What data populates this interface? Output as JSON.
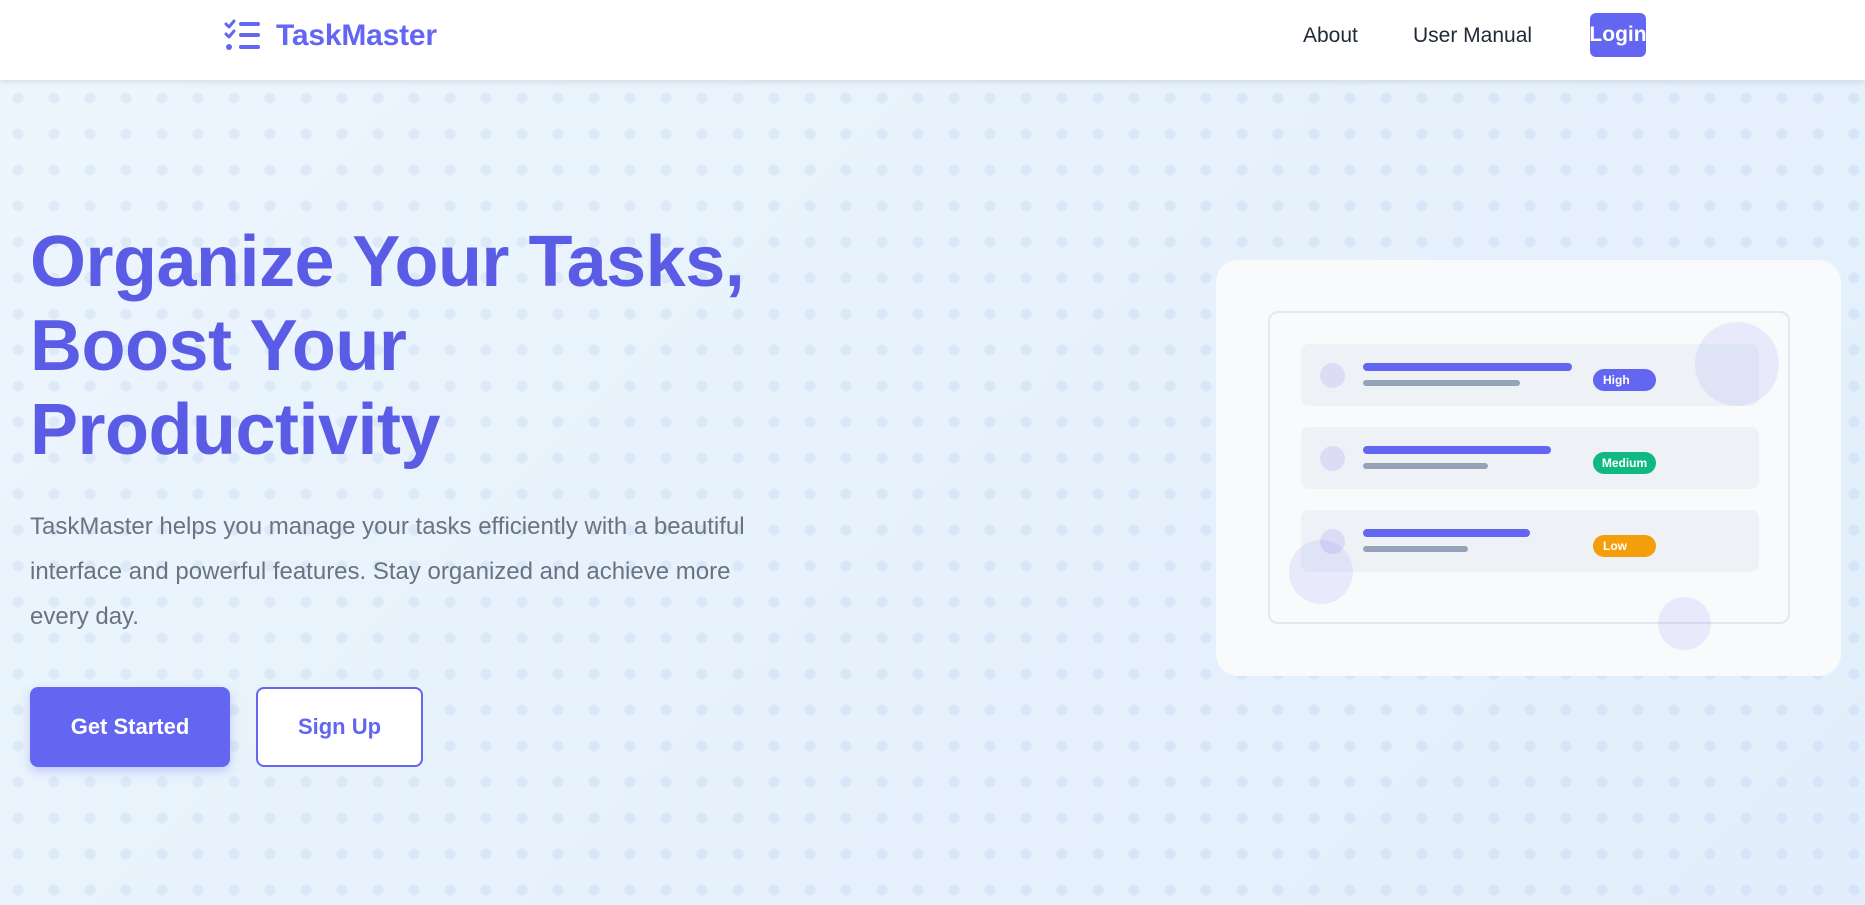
{
  "header": {
    "brand_name": "TaskMaster",
    "brand_icon": "task-list-icon",
    "nav": {
      "about": "About",
      "user_manual": "User Manual",
      "login": "Login"
    }
  },
  "hero": {
    "title_lines": [
      "Organize Your Tasks,",
      "Boost Your",
      "Productivity"
    ],
    "description": "TaskMaster helps you manage your tasks efficiently with a beautiful interface and powerful features. Stay organized and achieve more every day.",
    "primary_button": "Get Started",
    "secondary_button": "Sign Up"
  },
  "illustration": {
    "tasks": [
      {
        "priority": "High",
        "color": "#6366f1"
      },
      {
        "priority": "Medium",
        "color": "#10b981"
      },
      {
        "priority": "Low",
        "color": "#f59e0b"
      }
    ]
  },
  "colors": {
    "accent": "#6366f1",
    "title": "#5b5ce6",
    "text_muted": "#6b7280",
    "high": "#6366f1",
    "medium": "#10b981",
    "low": "#f59e0b"
  }
}
